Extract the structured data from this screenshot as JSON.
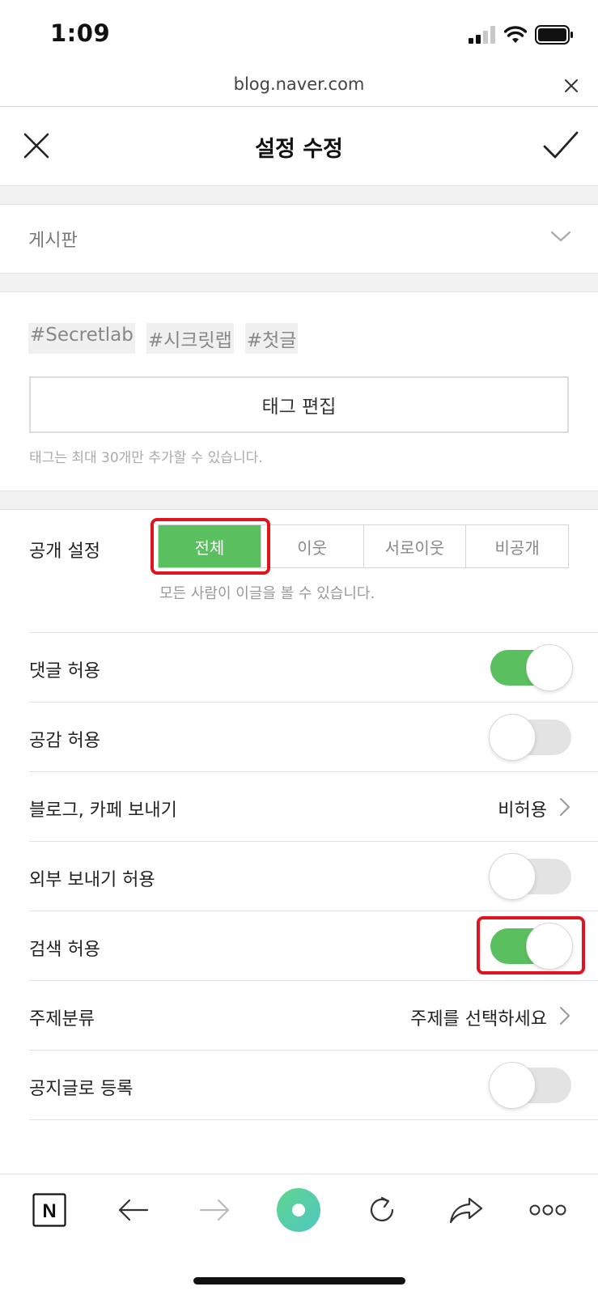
{
  "status_bar": {
    "time": "1:09"
  },
  "browser": {
    "url": "blog.naver.com"
  },
  "header": {
    "title": "설정 수정"
  },
  "board": {
    "label": "게시판"
  },
  "tags": {
    "items": [
      "#Secretlab",
      "#시크릿랩",
      "#첫글"
    ],
    "edit_button": "태그 편집",
    "hint": "태그는 최대 30개만 추가할 수 있습니다."
  },
  "visibility": {
    "label": "공개 설정",
    "options": [
      "전체",
      "이웃",
      "서로이웃",
      "비공개"
    ],
    "selected": "전체",
    "hint": "모든 사람이 이글을 볼 수 있습니다."
  },
  "settings": {
    "comments": {
      "label": "댓글 허용",
      "enabled": true
    },
    "likes": {
      "label": "공감 허용",
      "enabled": false
    },
    "send_blog_cafe": {
      "label": "블로그, 카페 보내기",
      "value": "비허용"
    },
    "external_send": {
      "label": "외부 보내기 허용",
      "enabled": false
    },
    "search": {
      "label": "검색 허용",
      "enabled": true
    },
    "topic": {
      "label": "주제분류",
      "value": "주제를 선택하세요"
    },
    "notice": {
      "label": "공지글로 등록",
      "enabled": false
    }
  },
  "colors": {
    "accent_green": "#5ac05f",
    "highlight_red": "#e0141e",
    "logo": "N"
  },
  "icons": [
    "signal-icon",
    "wifi-icon",
    "battery-icon",
    "close-icon",
    "check-icon",
    "chevron-down-icon",
    "chevron-right-icon",
    "naver-home-icon",
    "back-arrow-icon",
    "forward-arrow-icon",
    "green-dot-icon",
    "refresh-icon",
    "share-icon",
    "more-icon"
  ]
}
